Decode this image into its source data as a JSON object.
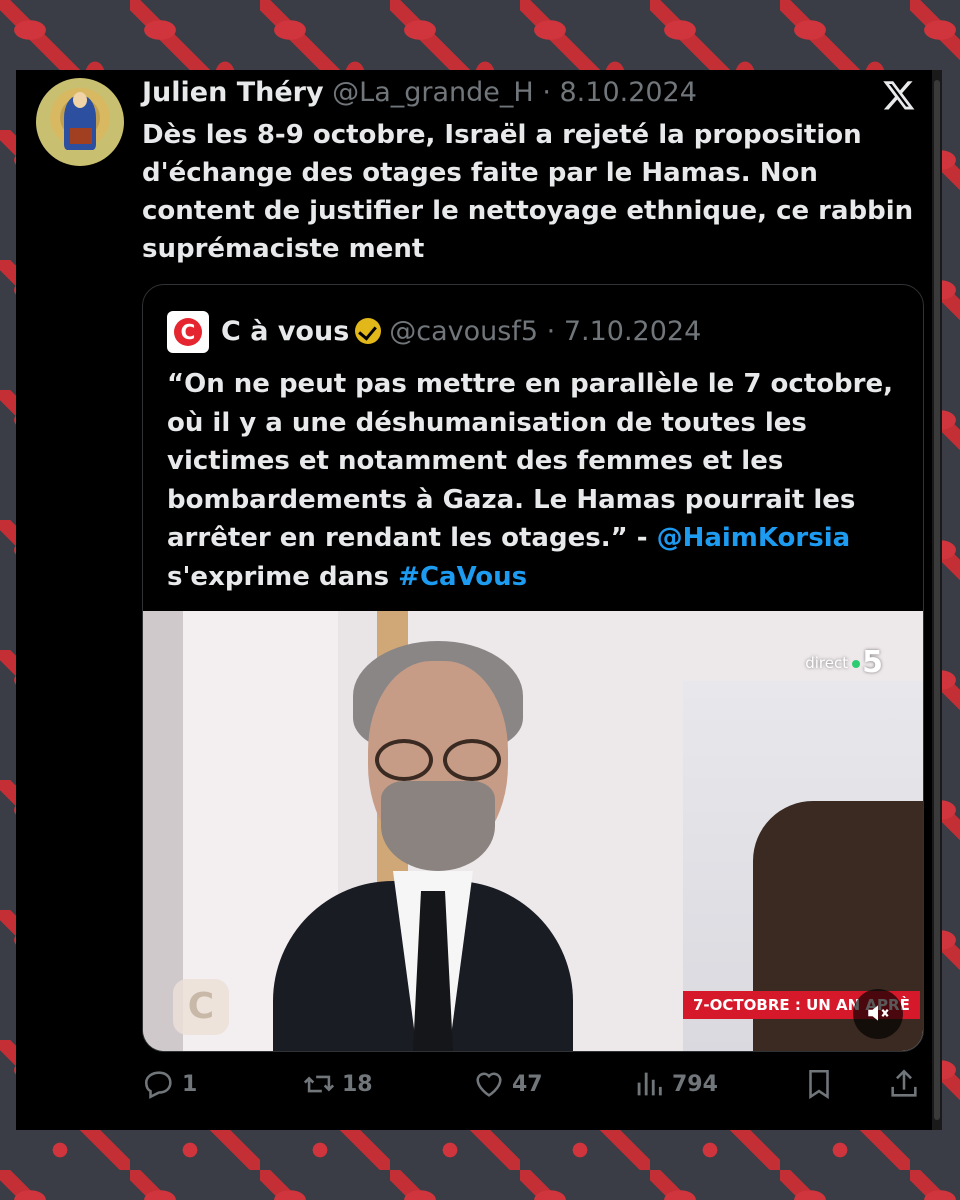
{
  "tweet": {
    "author_name": "Julien Théry",
    "handle": "@La_grande_H",
    "separator": "·",
    "date": "8.10.2024",
    "text": "Dès les 8-9 octobre, Israël a rejeté la proposition d'échange des otages faite par le Hamas. Non content de justifier le nettoyage ethnique, ce rabbin suprémaciste ment"
  },
  "quoted_tweet": {
    "author_name": "C à vous",
    "handle": "@cavousf5",
    "separator": "·",
    "date": "7.10.2024",
    "text_part1": "“On ne peut pas mettre en parallèle le 7 octobre, où il y a une déshumanisation de toutes les victimes et notamment des femmes et les bombardements à Gaza. Le Hamas pourrait les arrêter en rendant les otages.” - ",
    "mention": "@HaimKorsia",
    "text_part2": " s'exprime dans ",
    "hashtag": "#CaVous",
    "avatar_letter": "C",
    "media": {
      "channel_label": "direct",
      "channel_number": "5",
      "banner": "7-OCTOBRE : UN AN APRÈ",
      "watermark_letter": "C",
      "mute_icon": "speaker-muted-icon"
    }
  },
  "actions": {
    "replies": "1",
    "reposts": "18",
    "likes": "47",
    "views": "794"
  },
  "colors": {
    "background": "#000000",
    "text": "#e7e9ea",
    "muted": "#71767b",
    "link": "#1d9bf0",
    "verified": "#e2b719",
    "frame_red": "#d0343c",
    "frame_gray": "#3a3d46"
  }
}
